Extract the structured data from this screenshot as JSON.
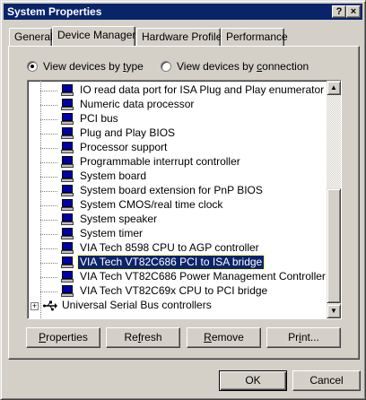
{
  "window": {
    "title": "System Properties"
  },
  "titlebar_buttons": {
    "help": "?",
    "close": "×"
  },
  "tabs": [
    {
      "label": "General"
    },
    {
      "label": "Device Manager"
    },
    {
      "label": "Hardware Profiles"
    },
    {
      "label": "Performance"
    }
  ],
  "view_options": {
    "by_type": {
      "pre": "View devices by ",
      "u": "t",
      "post": "ype"
    },
    "by_connection": {
      "pre": "View devices by ",
      "u": "c",
      "post": "onnection"
    }
  },
  "devices": [
    {
      "label": "IO read data port for ISA Plug and Play enumerator"
    },
    {
      "label": "Numeric data processor"
    },
    {
      "label": "PCI bus"
    },
    {
      "label": "Plug and Play BIOS"
    },
    {
      "label": "Processor support"
    },
    {
      "label": "Programmable interrupt controller"
    },
    {
      "label": "System board"
    },
    {
      "label": "System board extension for PnP BIOS"
    },
    {
      "label": "System CMOS/real time clock"
    },
    {
      "label": "System speaker"
    },
    {
      "label": "System timer"
    },
    {
      "label": "VIA Tech 8598 CPU to AGP controller"
    },
    {
      "label": "VIA Tech VT82C686 PCI to ISA bridge",
      "selected": true
    },
    {
      "label": "VIA Tech VT82C686 Power Management Controller"
    },
    {
      "label": "VIA Tech VT82C69x CPU to PCI bridge"
    }
  ],
  "usb_category": {
    "label": "Universal Serial Bus controllers",
    "expander": "+"
  },
  "scroll_arrows": {
    "up": "▲",
    "down": "▼"
  },
  "buttons": {
    "properties": {
      "u": "P",
      "rest": "roperties"
    },
    "refresh": {
      "pre": "Re",
      "u": "f",
      "rest": "resh"
    },
    "remove": {
      "pre": "",
      "u": "R",
      "rest": "emove"
    },
    "print": {
      "pre": "Pr",
      "u": "i",
      "rest": "nt..."
    },
    "ok": "OK",
    "cancel": "Cancel"
  },
  "colors": {
    "selection": "#0a246a",
    "titlebar": "#0a246a",
    "face": "#d4d0c8"
  }
}
